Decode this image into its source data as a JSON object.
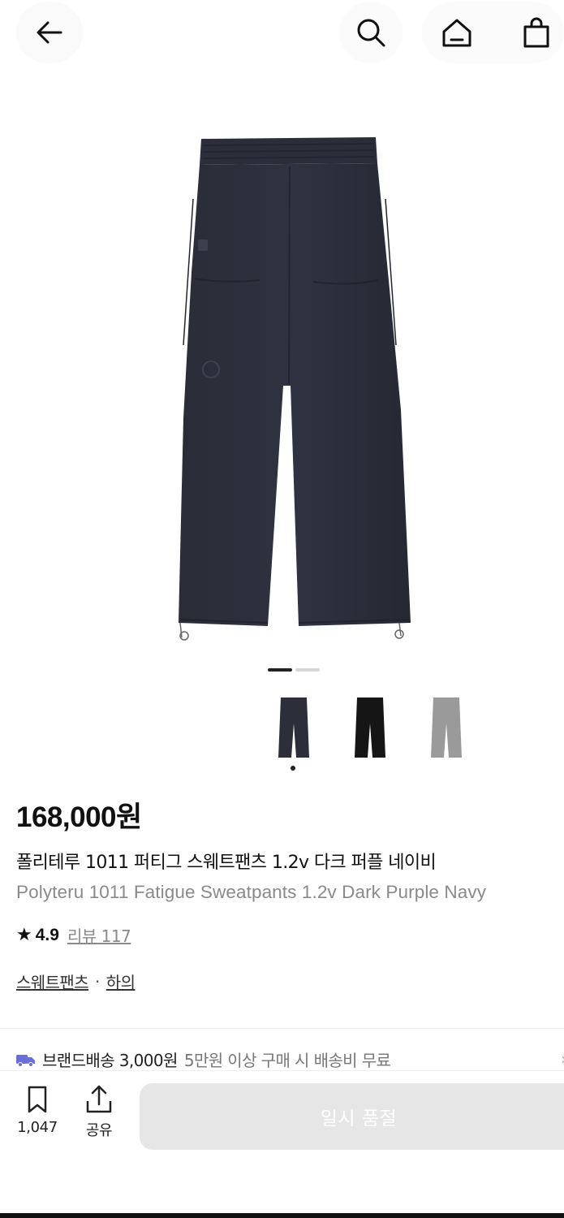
{
  "header": {
    "icons": [
      "back-arrow-icon",
      "search-icon",
      "home-icon",
      "shopping-bag-icon"
    ]
  },
  "gallery": {
    "thumbnail_colors": [
      "#2c2f3a",
      "#151515",
      "#9a9a9a"
    ]
  },
  "product": {
    "price": "168,000원",
    "name_ko": "폴리테루 1011 퍼티그 스웨트팬츠 1.2v 다크 퍼플 네이비",
    "name_en": "Polyteru 1011 Fatigue Sweatpants 1.2v Dark Purple Navy",
    "rating": "4.9",
    "review_label": "리뷰 117",
    "category": "스웨트팬츠",
    "separator": "·",
    "subcategory": "하의"
  },
  "shipping": {
    "label": "브랜드배송 3,000원",
    "note": "5만원 이상 구매 시 배송비 무료",
    "chevron": "›",
    "truck_color": "#6a6fd8"
  },
  "bottom_bar": {
    "like_count": "1,047",
    "share_label": "공유",
    "cta_label": "일시 품절"
  },
  "colors": {
    "cta_bg": "#e6e6e6",
    "muted_text": "#8a8a8a"
  }
}
